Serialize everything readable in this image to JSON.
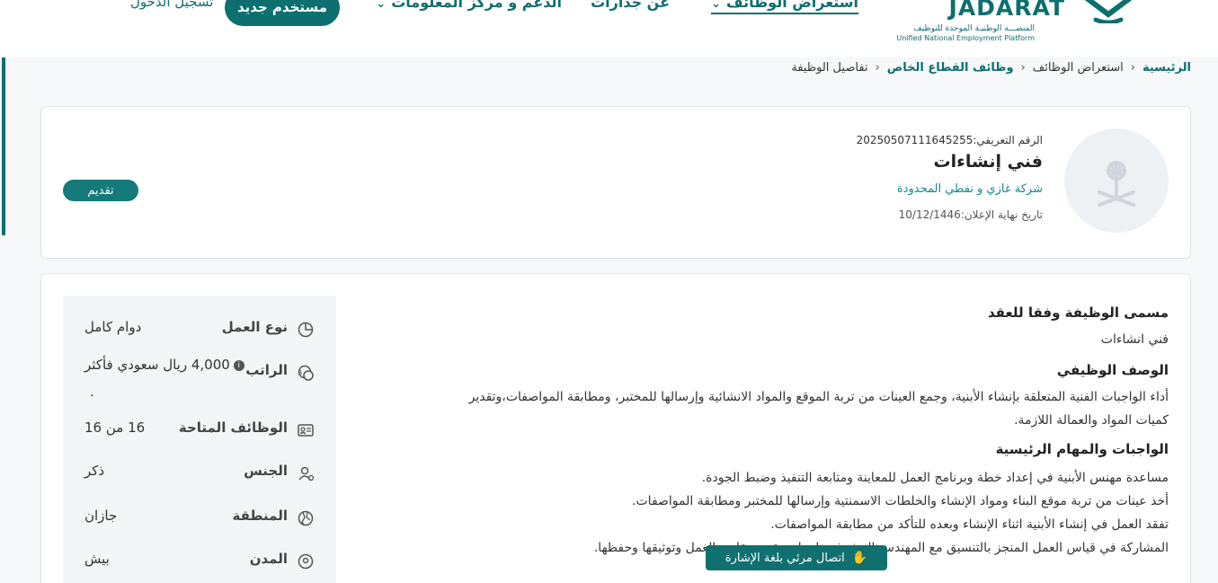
{
  "header": {
    "logo": {
      "brand": "JADARAT",
      "subtitle_ar": "المنصـــة الوطنيـة الموحدة للتوظيف",
      "subtitle_en": "Unified National Employment Platform"
    },
    "nav": [
      {
        "label": "استعراض الوظائف",
        "has_dropdown": true,
        "active": true
      },
      {
        "label": "عن جدارات",
        "has_dropdown": false,
        "active": false
      },
      {
        "label": "الدعم و مركز المعلومات",
        "has_dropdown": true,
        "active": false
      }
    ],
    "register_label": "مستخدم جديد",
    "login_label": "تسجيل الدخول"
  },
  "breadcrumb": {
    "items": [
      "الرئيسية",
      "استعراض الوظائف",
      "وظائف القطاع الخاص",
      "تفاصيل الوظيفة"
    ],
    "separator": "‹"
  },
  "job": {
    "id_text": "الرقم التعريفي:20250507111645255",
    "title": "فني إنشاءات",
    "company": "شركة غازي و نفطي المحدودة",
    "deadline_text": "تاريخ نهاية الإعلان:10/12/1446",
    "apply_label": "تقديم"
  },
  "details": {
    "sections": [
      {
        "title": "مسمى الوظيفة وفقا للعقد",
        "lines": [
          "فني انشاءات"
        ]
      },
      {
        "title": "الوصف الوظيفي",
        "lines": [
          "أداء الواجبات الفنية المتعلقة بإنشاء الأبنية، وجمع العينات من تربة الموقع والمواد الانشائية وإرسالها للمختبر، ومطابقة المواصفات،وتقدير",
          "كميات المواد والعمالة اللازمة."
        ]
      },
      {
        "title": "الواجبات والمهام الرئيسية",
        "lines": [
          "مساعدة مهنس الأبنية في إعداد خطة وبرنامج العمل للمعاينة ومتابعة التنفيذ وضبط الجودة.",
          "أخذ عينات من تربة موقع البناء ومواد الإنشاء  والخلطات الاسمنتية وإرسالها للمختبر ومطابقة المواصفات.",
          "تفقد العمل في إنشاء الأبنية اثناء الإنشاء وبعده للتأكد من مطابقة المواصفات.",
          "المشاركة في قياس العمل المنجز بالتنسيق مع المهندس المشرف وإعداد وتقديم تقارير العمل وتوثيقها وحفظها."
        ]
      }
    ]
  },
  "info": [
    {
      "icon": "pie-chart-icon",
      "label": "نوع العمل",
      "value": "دوام كامل"
    },
    {
      "icon": "money-icon",
      "label": "الراتب",
      "value": "4,000 ريال سعودي فأكثر",
      "extra": "."
    },
    {
      "icon": "id-card-icon",
      "label": "الوظائف المتاحة",
      "value": "16  من 16"
    },
    {
      "icon": "gender-icon",
      "label": "الجنس",
      "value": "ذكر"
    },
    {
      "icon": "map-icon",
      "label": "المنطقة",
      "value": "جازان"
    },
    {
      "icon": "location-pin-icon",
      "label": "المدن",
      "value": "بيش"
    }
  ],
  "sign_language": {
    "label": "اتصال مرئي بلغة الإشارة",
    "icon": "hand-icon"
  },
  "colors": {
    "brand": "#0d6f6f",
    "background": "#f6f8f9",
    "panel": "#f3f5f6"
  }
}
